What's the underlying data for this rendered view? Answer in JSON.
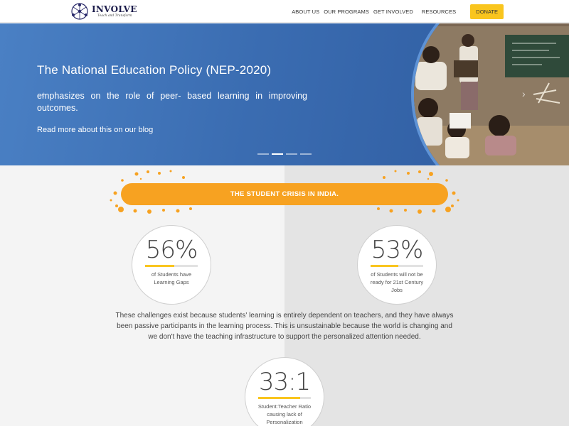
{
  "header": {
    "logo_name": "INVOLVE",
    "logo_tagline": "Teach and Transform",
    "nav": [
      "ABOUT US",
      "OUR PROGRAMS",
      "GET INVOLVED",
      "RESOURCES"
    ],
    "donate_label": "DONATE",
    "donate_color": "#f9c51e"
  },
  "hero": {
    "title": "The National Education Policy (NEP-2020)",
    "body": "emphasizes on the role of peer- based learning in improving outcomes.",
    "link": "Read more about this on our blog",
    "arrow_left_icon": "chevron-left-icon",
    "arrow_right_icon": "chevron-right-icon",
    "slide_count": 4,
    "active_slide": 2,
    "background_color": "#3a6cb1"
  },
  "crisis": {
    "banner": "THE STUDENT CRISIS IN INDIA.",
    "banner_color": "#f7a221",
    "stats": [
      {
        "value": "56%",
        "label": "of Students have Learning Gaps",
        "fill_percent": 56
      },
      {
        "value": "53%",
        "label": "of Students will not be ready for 21st Century Jobs",
        "fill_percent": 53
      },
      {
        "value": "33:1",
        "label": "Student:Teacher Ratio causing lack of Personalization",
        "fill_percent": 80
      }
    ],
    "explanation": "These challenges exist because students' learning is entirely dependent on teachers, and they have always been passive participants in the learning process. This is unsustainable because the world is changing and we don't have the teaching infrastructure to support the personalized attention needed."
  }
}
